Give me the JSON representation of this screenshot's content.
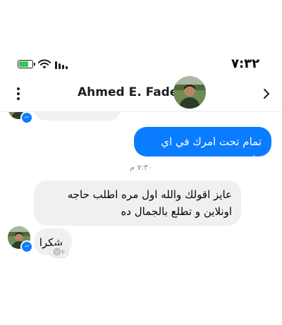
{
  "status_bar": {
    "time": "٧:٣٢",
    "battery_color": "#34c759",
    "icons": [
      "battery-charging-icon",
      "wifi-icon",
      "signal-icon"
    ]
  },
  "header": {
    "contact_name": "Ahmed E. Fadel",
    "icons": [
      "more-vertical-icon",
      "chevron-right-icon"
    ]
  },
  "conversation": {
    "messages": [
      {
        "direction": "outgoing",
        "text": "تمام تحت امرك في اي وقت"
      },
      {
        "type": "timestamp",
        "text": "٧:٣٠ م"
      },
      {
        "direction": "incoming",
        "text": "عايز اقولك والله اول مره اطلب حاجه اونلاين و تطلع بالجمال ده"
      },
      {
        "direction": "incoming",
        "text": "شكرا"
      }
    ]
  },
  "colors": {
    "outgoing_bubble": "#0a7cff",
    "incoming_bubble": "#f0f0f0",
    "messenger_badge": "#0a7cff"
  }
}
